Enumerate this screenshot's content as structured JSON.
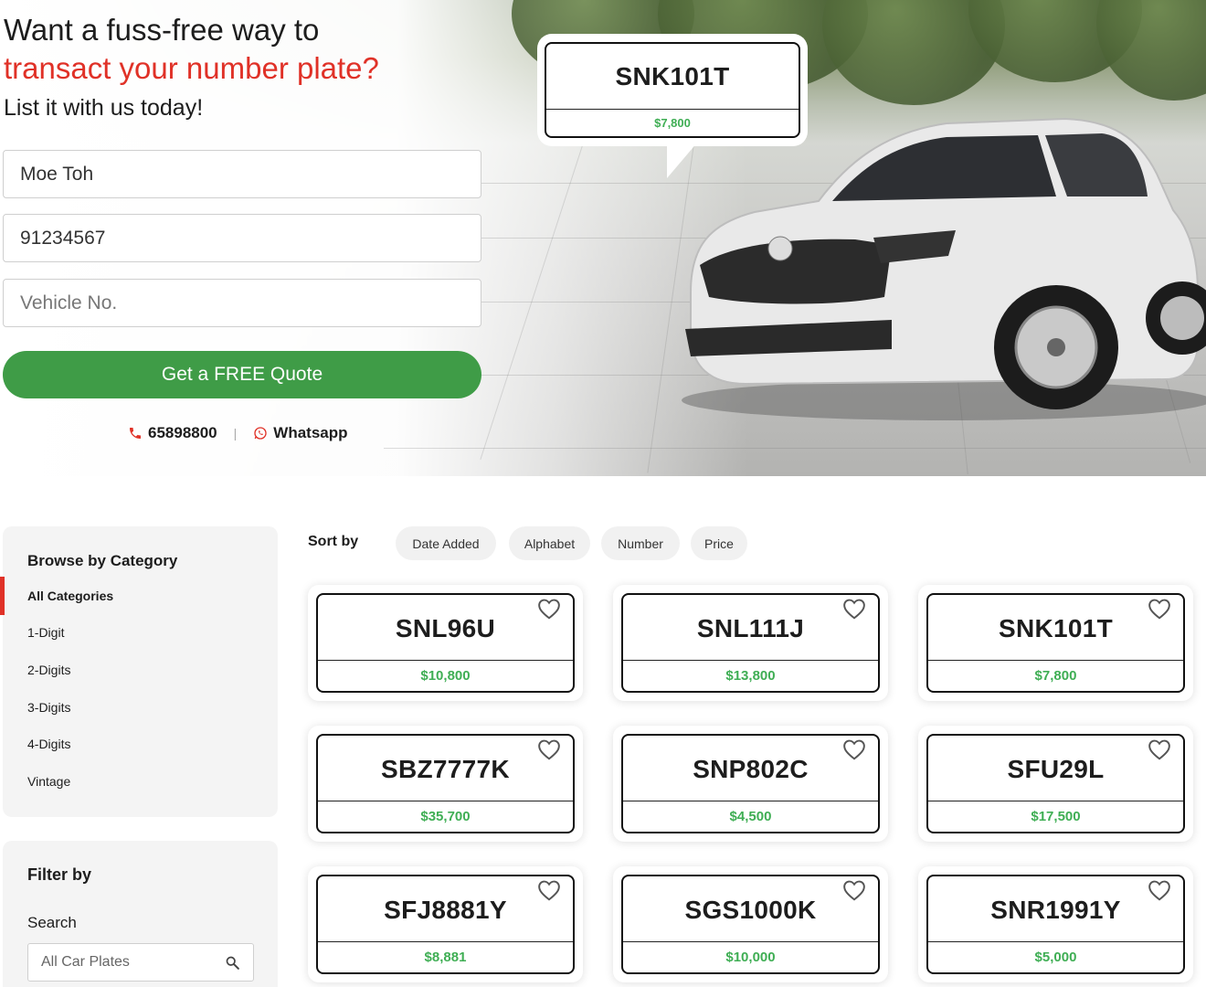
{
  "hero": {
    "title_line1": "Want a fuss-free way to",
    "title_line2": "transact your number plate?",
    "subtitle": "List it with us today!",
    "form": {
      "name_value": "Moe Toh",
      "phone_value": "91234567",
      "vehicle_placeholder": "Vehicle No.",
      "submit_label": "Get a FREE Quote"
    },
    "contact": {
      "phone": "65898800",
      "separator": "|",
      "whatsapp": "Whatsapp"
    },
    "featured_plate": {
      "number": "SNK101T",
      "price": "$7,800"
    }
  },
  "colors": {
    "accent_red": "#e03127",
    "button_green": "#3f9c47",
    "price_green": "#3fae54"
  },
  "sidebar": {
    "category_title": "Browse by Category",
    "categories": [
      "All Categories",
      "1-Digit",
      "2-Digits",
      "3-Digits",
      "4-Digits",
      "Vintage"
    ],
    "active_category": "All Categories",
    "filter_title": "Filter by",
    "search_label": "Search",
    "search_placeholder": "All Car Plates"
  },
  "sort": {
    "label": "Sort by",
    "options": [
      "Date Added",
      "Alphabet",
      "Number",
      "Price"
    ]
  },
  "plates": [
    {
      "number": "SNL96U",
      "price": "$10,800"
    },
    {
      "number": "SNL111J",
      "price": "$13,800"
    },
    {
      "number": "SNK101T",
      "price": "$7,800"
    },
    {
      "number": "SBZ7777K",
      "price": "$35,700"
    },
    {
      "number": "SNP802C",
      "price": "$4,500"
    },
    {
      "number": "SFU29L",
      "price": "$17,500"
    },
    {
      "number": "SFJ8881Y",
      "price": "$8,881"
    },
    {
      "number": "SGS1000K",
      "price": "$10,000"
    },
    {
      "number": "SNR1991Y",
      "price": "$5,000"
    }
  ]
}
